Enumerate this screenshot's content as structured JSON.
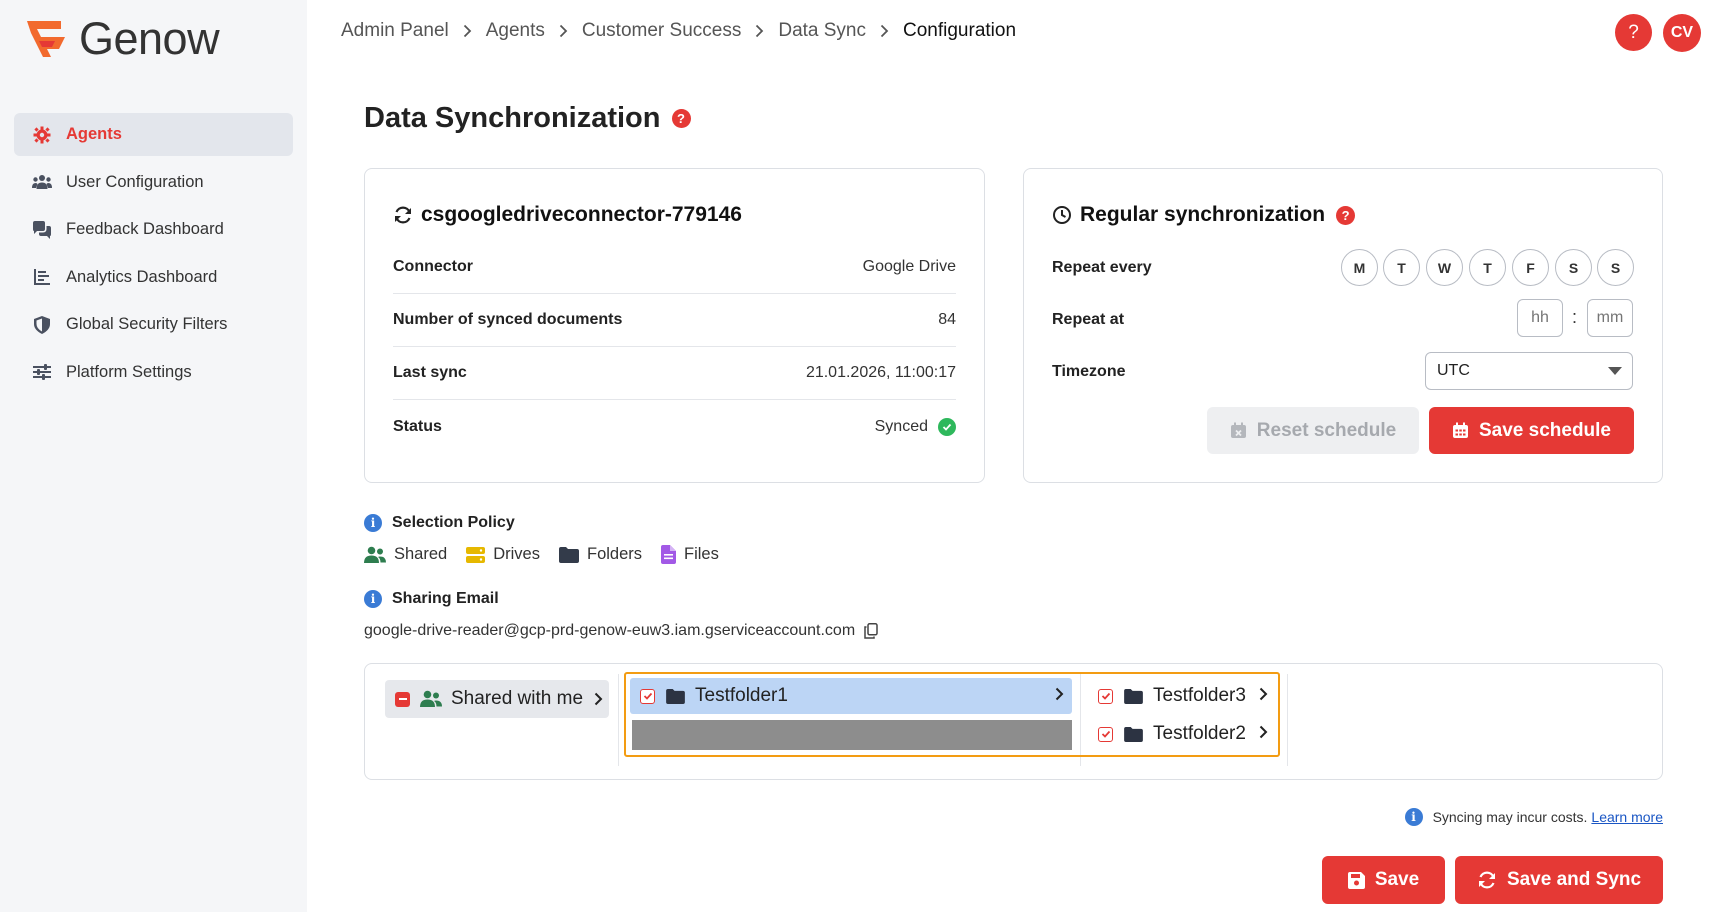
{
  "brand": {
    "name": "Genow"
  },
  "nav": [
    {
      "label": "Agents",
      "icon": "gear-icon",
      "active": true
    },
    {
      "label": "User Configuration",
      "icon": "users-icon"
    },
    {
      "label": "Feedback Dashboard",
      "icon": "chat-bubbles-icon"
    },
    {
      "label": "Analytics Dashboard",
      "icon": "bar-chart-icon"
    },
    {
      "label": "Global Security Filters",
      "icon": "shield-icon"
    },
    {
      "label": "Platform Settings",
      "icon": "sliders-icon"
    }
  ],
  "breadcrumb": [
    "Admin Panel",
    "Agents",
    "Customer Success",
    "Data Sync",
    "Configuration"
  ],
  "header": {
    "help_label": "?",
    "avatar_initials": "CV"
  },
  "page": {
    "title": "Data Synchronization"
  },
  "connector_card": {
    "title": "csgoogledriveconnector-779146",
    "rows": [
      {
        "label": "Connector",
        "value": "Google Drive"
      },
      {
        "label": "Number of synced documents",
        "value": "84"
      },
      {
        "label": "Last sync",
        "value": "21.01.2026, 11:00:17"
      },
      {
        "label": "Status",
        "value": "Synced"
      }
    ]
  },
  "schedule_card": {
    "title": "Regular synchronization",
    "repeat_every_label": "Repeat every",
    "days": [
      "M",
      "T",
      "W",
      "T",
      "F",
      "S",
      "S"
    ],
    "repeat_at_label": "Repeat at",
    "hour_placeholder": "hh",
    "minute_placeholder": "mm",
    "time_separator": ":",
    "timezone_label": "Timezone",
    "timezone_value": "UTC",
    "reset_label": "Reset schedule",
    "save_label": "Save schedule"
  },
  "selection_policy": {
    "heading": "Selection Policy",
    "items": [
      {
        "label": "Shared",
        "icon": "users-icon",
        "color": "#2e7d4f"
      },
      {
        "label": "Drives",
        "icon": "drive-icon",
        "color": "#e6b800"
      },
      {
        "label": "Folders",
        "icon": "folder-icon",
        "color": "#333b4a"
      },
      {
        "label": "Files",
        "icon": "file-icon",
        "color": "#a259e6"
      }
    ]
  },
  "sharing_email": {
    "heading": "Sharing Email",
    "address": "google-drive-reader@gcp-prd-genow-euw3.iam.gserviceaccount.com"
  },
  "browser": {
    "root": {
      "label": "Shared with me"
    },
    "column1": [
      {
        "label": "Testfolder1",
        "checked": true,
        "selected": true
      }
    ],
    "column2": [
      {
        "label": "Testfolder3",
        "checked": true
      },
      {
        "label": "Testfolder2",
        "checked": true
      }
    ]
  },
  "cost_note": {
    "text": "Syncing may incur costs.",
    "link": "Learn more"
  },
  "footer": {
    "save_label": "Save",
    "save_sync_label": "Save and Sync"
  },
  "colors": {
    "accent": "#e53935",
    "info": "#3a7bd5",
    "success": "#2eb85c",
    "highlight": "#f39c12"
  }
}
